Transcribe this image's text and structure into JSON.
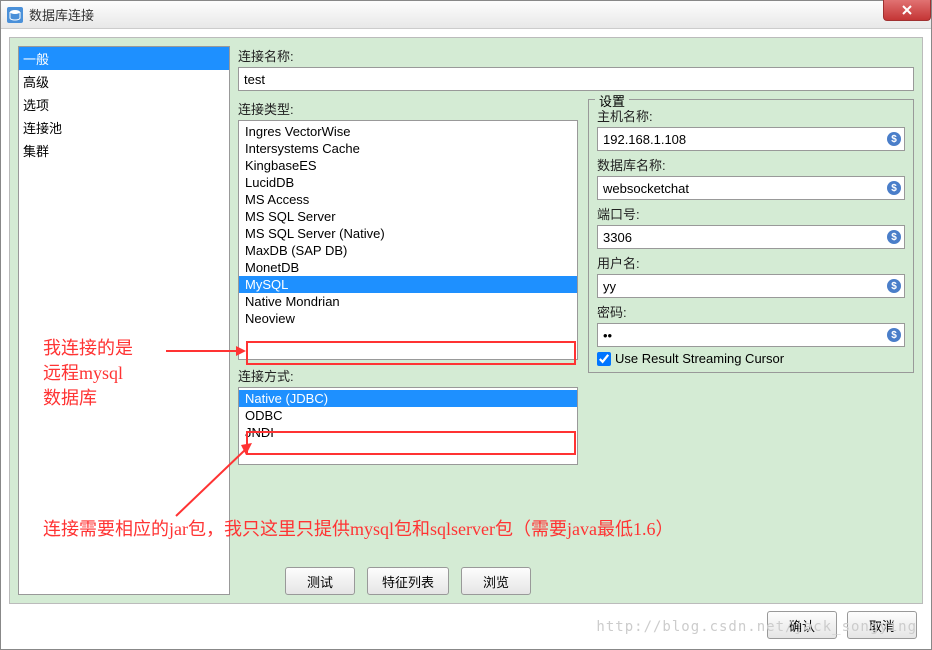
{
  "window": {
    "title": "数据库连接"
  },
  "sidebar": {
    "items": [
      {
        "label": "一般",
        "selected": true
      },
      {
        "label": "高级"
      },
      {
        "label": "选项"
      },
      {
        "label": "连接池"
      },
      {
        "label": "集群"
      }
    ]
  },
  "main": {
    "name_label": "连接名称:",
    "name_value": "test",
    "type_label": "连接类型:",
    "type_items": [
      "Ingres VectorWise",
      "Intersystems Cache",
      "KingbaseES",
      "LucidDB",
      "MS Access",
      "MS SQL Server",
      "MS SQL Server (Native)",
      "MaxDB (SAP DB)",
      "MonetDB",
      "MySQL",
      "Native Mondrian",
      "Neoview"
    ],
    "type_selected": "MySQL",
    "method_label": "连接方式:",
    "method_items": [
      "Native (JDBC)",
      "ODBC",
      "JNDI"
    ],
    "method_selected": "Native (JDBC)",
    "settings_legend": "设置",
    "host_label": "主机名称:",
    "host_value": "192.168.1.108",
    "db_label": "数据库名称:",
    "db_value": "websocketchat",
    "port_label": "端口号:",
    "port_value": "3306",
    "user_label": "用户名:",
    "user_value": "yy",
    "pass_label": "密码:",
    "pass_value": "••",
    "streaming_label": "Use Result Streaming Cursor",
    "test_btn": "测试",
    "feature_btn": "特征列表",
    "browse_btn": "浏览",
    "ok_btn": "确认",
    "cancel_btn": "取消"
  },
  "annotations": {
    "a1": "我连接的是\n远程mysql\n数据库",
    "a2": "连接需要相应的jar包，我只这里只提供mysql包和sqlserver包（需要java最低1.6）"
  },
  "watermark": "http://blog.csdn.net/jack_songying"
}
